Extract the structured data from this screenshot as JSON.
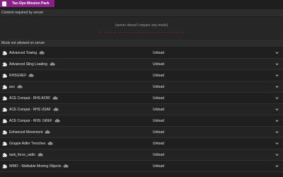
{
  "tab": {
    "label": "Tac-Ops Mission Pack"
  },
  "content_section": {
    "header": "Content required by server",
    "note": "(server doesn't require any mods)",
    "warning": "— — — — — — — — — — — — — — — — — —"
  },
  "mods_section": {
    "header": "Mods not allowed on server",
    "action_label": "Unload",
    "items": [
      {
        "name": "Advanced Towing"
      },
      {
        "name": "Advanced Sling Loading"
      },
      {
        "name": "RHSGREF"
      },
      {
        "name": "ace"
      },
      {
        "name": "ACE Compat - RHS AFRF"
      },
      {
        "name": "ACE Compat - RHS USAF"
      },
      {
        "name": "ACE Compat - RHS: GREF"
      },
      {
        "name": "Enhanced Movement"
      },
      {
        "name": "Gruppe Adler Trenches"
      },
      {
        "name": "task_force_radio"
      },
      {
        "name": "WMO - Walkable Moving Objects"
      }
    ]
  },
  "colors": {
    "tab_bg": "#8a1f8a",
    "warning": "#c21b1b",
    "background": "#1e1e1e"
  },
  "icons": {
    "tab": "pack-icon",
    "mod": "puzzle-icon",
    "cloud": "cloud-icon",
    "expand": "chevron-down-icon"
  }
}
